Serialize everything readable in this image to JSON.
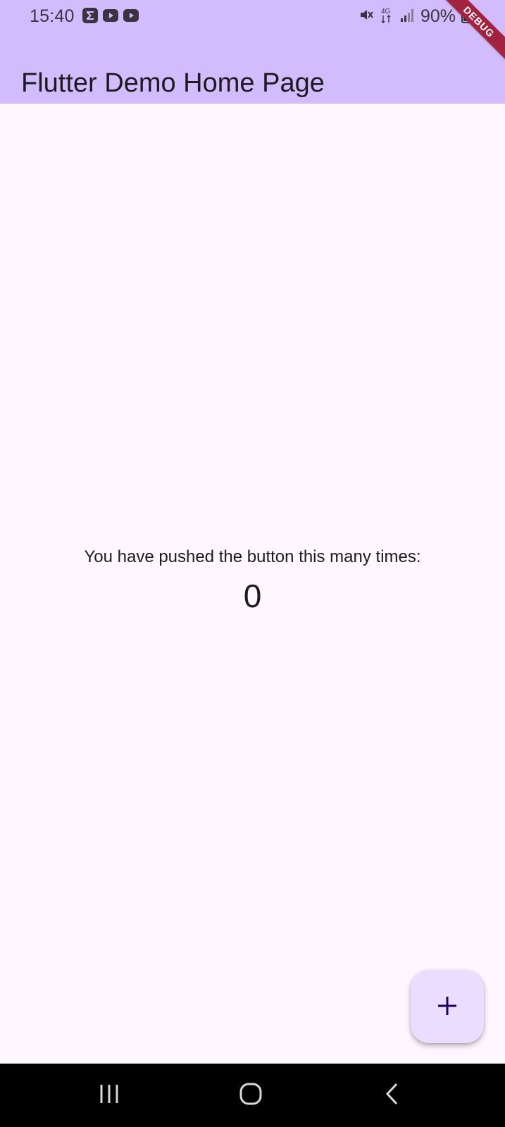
{
  "status_bar": {
    "time": "15:40",
    "notification_icons": [
      "sigma-app-icon",
      "youtube-icon",
      "youtube-icon"
    ],
    "network": "4G",
    "battery": "90%"
  },
  "app_bar": {
    "title": "Flutter Demo Home Page",
    "background_color": "#d3bcfd"
  },
  "debug_banner": {
    "label": "DEBUG",
    "color": "#a3233e"
  },
  "counter": {
    "label": "You have pushed the button this many times:",
    "value": "0"
  },
  "fab": {
    "icon": "plus-icon",
    "background_color": "#eaddff"
  },
  "nav_bar": {
    "buttons": [
      "recent-apps-icon",
      "home-icon",
      "back-icon"
    ]
  }
}
